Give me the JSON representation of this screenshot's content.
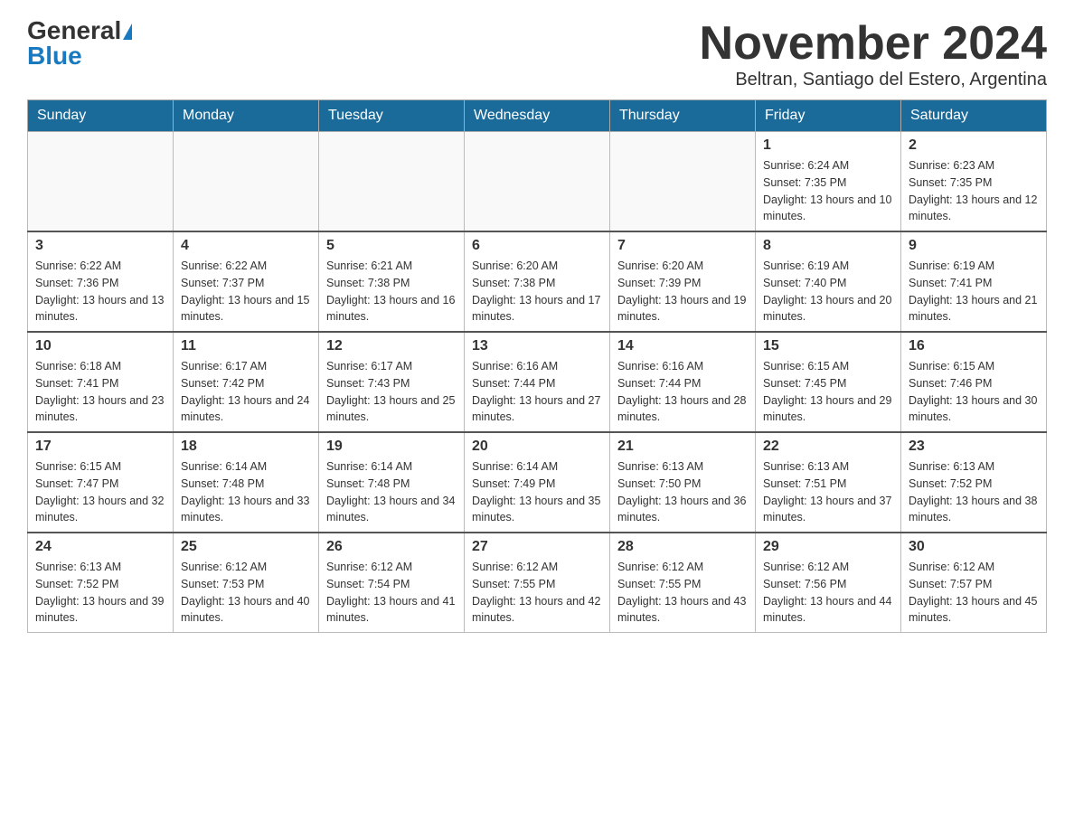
{
  "logo": {
    "general": "General",
    "blue": "Blue"
  },
  "title": "November 2024",
  "location": "Beltran, Santiago del Estero, Argentina",
  "days_of_week": [
    "Sunday",
    "Monday",
    "Tuesday",
    "Wednesday",
    "Thursday",
    "Friday",
    "Saturday"
  ],
  "weeks": [
    [
      {
        "day": "",
        "info": ""
      },
      {
        "day": "",
        "info": ""
      },
      {
        "day": "",
        "info": ""
      },
      {
        "day": "",
        "info": ""
      },
      {
        "day": "",
        "info": ""
      },
      {
        "day": "1",
        "info": "Sunrise: 6:24 AM\nSunset: 7:35 PM\nDaylight: 13 hours and 10 minutes."
      },
      {
        "day": "2",
        "info": "Sunrise: 6:23 AM\nSunset: 7:35 PM\nDaylight: 13 hours and 12 minutes."
      }
    ],
    [
      {
        "day": "3",
        "info": "Sunrise: 6:22 AM\nSunset: 7:36 PM\nDaylight: 13 hours and 13 minutes."
      },
      {
        "day": "4",
        "info": "Sunrise: 6:22 AM\nSunset: 7:37 PM\nDaylight: 13 hours and 15 minutes."
      },
      {
        "day": "5",
        "info": "Sunrise: 6:21 AM\nSunset: 7:38 PM\nDaylight: 13 hours and 16 minutes."
      },
      {
        "day": "6",
        "info": "Sunrise: 6:20 AM\nSunset: 7:38 PM\nDaylight: 13 hours and 17 minutes."
      },
      {
        "day": "7",
        "info": "Sunrise: 6:20 AM\nSunset: 7:39 PM\nDaylight: 13 hours and 19 minutes."
      },
      {
        "day": "8",
        "info": "Sunrise: 6:19 AM\nSunset: 7:40 PM\nDaylight: 13 hours and 20 minutes."
      },
      {
        "day": "9",
        "info": "Sunrise: 6:19 AM\nSunset: 7:41 PM\nDaylight: 13 hours and 21 minutes."
      }
    ],
    [
      {
        "day": "10",
        "info": "Sunrise: 6:18 AM\nSunset: 7:41 PM\nDaylight: 13 hours and 23 minutes."
      },
      {
        "day": "11",
        "info": "Sunrise: 6:17 AM\nSunset: 7:42 PM\nDaylight: 13 hours and 24 minutes."
      },
      {
        "day": "12",
        "info": "Sunrise: 6:17 AM\nSunset: 7:43 PM\nDaylight: 13 hours and 25 minutes."
      },
      {
        "day": "13",
        "info": "Sunrise: 6:16 AM\nSunset: 7:44 PM\nDaylight: 13 hours and 27 minutes."
      },
      {
        "day": "14",
        "info": "Sunrise: 6:16 AM\nSunset: 7:44 PM\nDaylight: 13 hours and 28 minutes."
      },
      {
        "day": "15",
        "info": "Sunrise: 6:15 AM\nSunset: 7:45 PM\nDaylight: 13 hours and 29 minutes."
      },
      {
        "day": "16",
        "info": "Sunrise: 6:15 AM\nSunset: 7:46 PM\nDaylight: 13 hours and 30 minutes."
      }
    ],
    [
      {
        "day": "17",
        "info": "Sunrise: 6:15 AM\nSunset: 7:47 PM\nDaylight: 13 hours and 32 minutes."
      },
      {
        "day": "18",
        "info": "Sunrise: 6:14 AM\nSunset: 7:48 PM\nDaylight: 13 hours and 33 minutes."
      },
      {
        "day": "19",
        "info": "Sunrise: 6:14 AM\nSunset: 7:48 PM\nDaylight: 13 hours and 34 minutes."
      },
      {
        "day": "20",
        "info": "Sunrise: 6:14 AM\nSunset: 7:49 PM\nDaylight: 13 hours and 35 minutes."
      },
      {
        "day": "21",
        "info": "Sunrise: 6:13 AM\nSunset: 7:50 PM\nDaylight: 13 hours and 36 minutes."
      },
      {
        "day": "22",
        "info": "Sunrise: 6:13 AM\nSunset: 7:51 PM\nDaylight: 13 hours and 37 minutes."
      },
      {
        "day": "23",
        "info": "Sunrise: 6:13 AM\nSunset: 7:52 PM\nDaylight: 13 hours and 38 minutes."
      }
    ],
    [
      {
        "day": "24",
        "info": "Sunrise: 6:13 AM\nSunset: 7:52 PM\nDaylight: 13 hours and 39 minutes."
      },
      {
        "day": "25",
        "info": "Sunrise: 6:12 AM\nSunset: 7:53 PM\nDaylight: 13 hours and 40 minutes."
      },
      {
        "day": "26",
        "info": "Sunrise: 6:12 AM\nSunset: 7:54 PM\nDaylight: 13 hours and 41 minutes."
      },
      {
        "day": "27",
        "info": "Sunrise: 6:12 AM\nSunset: 7:55 PM\nDaylight: 13 hours and 42 minutes."
      },
      {
        "day": "28",
        "info": "Sunrise: 6:12 AM\nSunset: 7:55 PM\nDaylight: 13 hours and 43 minutes."
      },
      {
        "day": "29",
        "info": "Sunrise: 6:12 AM\nSunset: 7:56 PM\nDaylight: 13 hours and 44 minutes."
      },
      {
        "day": "30",
        "info": "Sunrise: 6:12 AM\nSunset: 7:57 PM\nDaylight: 13 hours and 45 minutes."
      }
    ]
  ]
}
